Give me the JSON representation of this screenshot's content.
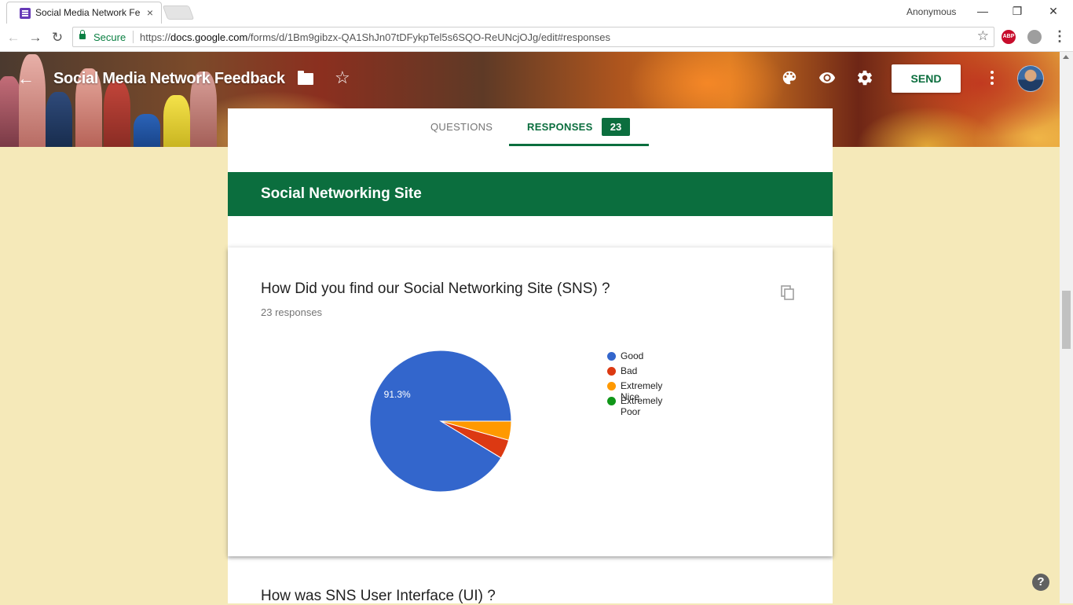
{
  "browser": {
    "tab_title": "Social Media Network Fe",
    "tab_close": "×",
    "profile": "Anonymous",
    "window_controls": [
      "—",
      "❐",
      "✕"
    ],
    "secure_label": "Secure",
    "url_prefix": "https://",
    "url_host": "docs.google.com",
    "url_path": "/forms/d/1Bm9gibzx-QA1ShJn07tDFykpTel5s6SQO-ReUNcjOJg/edit#responses",
    "abp": "ABP",
    "menu": "⋮"
  },
  "header": {
    "title": "Social Media Network Feedback",
    "send_label": "SEND",
    "icons": [
      "arrow-back-icon",
      "folder-icon",
      "star-icon",
      "palette-icon",
      "eye-icon",
      "gear-icon",
      "more-vert-icon"
    ]
  },
  "tabs": {
    "questions": "QUESTIONS",
    "responses": "RESPONSES",
    "response_count": "23"
  },
  "section": {
    "title": "Social Networking Site"
  },
  "question1": {
    "title": "How Did you find our Social Networking Site (SNS) ?",
    "responses_text": "23 responses"
  },
  "question2": {
    "title": "How was SNS User Interface (UI) ?"
  },
  "help": "?",
  "colors": {
    "brand_green": "#0b6e3e",
    "page_bg": "#f5e9b9"
  },
  "chart_data": {
    "type": "pie",
    "categories": [
      "Good",
      "Bad",
      "Extremely Nice",
      "Extremely Poor"
    ],
    "values": [
      21,
      1,
      1,
      0
    ],
    "colors": [
      "#3366cc",
      "#dc3912",
      "#ff9900",
      "#109618"
    ],
    "data_labels": [
      "91.3%"
    ],
    "legend": "right"
  }
}
